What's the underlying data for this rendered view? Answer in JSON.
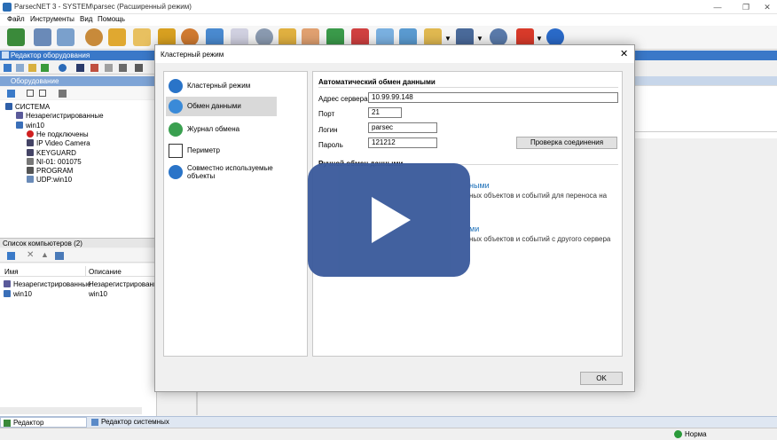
{
  "window": {
    "title": "ParsecNET 3 - SYSTEM\\parsec (Расширенный режим)"
  },
  "menu": [
    "Файл",
    "Инструменты",
    "Вид",
    "Помощь"
  ],
  "toolbar_icons": [
    "device-icon",
    "server-icon",
    "doc-icon",
    "person-icon",
    "home-icon",
    "grid-icon",
    "lock-icon",
    "group-icon",
    "monitor-icon",
    "calendar-icon",
    "gear-icon",
    "folder-icon",
    "table-icon",
    "chart-icon",
    "report-icon",
    "card-icon",
    "camera-icon",
    "export-icon",
    "network-icon",
    "user-icon",
    "delete-icon",
    "help-icon"
  ],
  "editor_panel": {
    "title": "Редактор оборудования"
  },
  "equipment_panel": {
    "title": "Оборудование"
  },
  "tree": [
    {
      "label": "СИСТЕМА",
      "level": 0,
      "icon": "system-icon",
      "color": "#2f5fa8"
    },
    {
      "label": "Незарегистрированные",
      "level": 1,
      "icon": "unregistered-icon",
      "color": "#5a5a9a"
    },
    {
      "label": "win10",
      "level": 1,
      "icon": "computer-icon",
      "color": "#3a6fb8"
    },
    {
      "label": "Не подключены",
      "level": 2,
      "icon": "disconnected-icon",
      "color": "#d02020"
    },
    {
      "label": "IP Video Camera",
      "level": 2,
      "icon": "camera-icon",
      "color": "#444466"
    },
    {
      "label": "KEYGUARD",
      "level": 2,
      "icon": "keyguard-icon",
      "color": "#444466"
    },
    {
      "label": "NI-01: 001075",
      "level": 2,
      "icon": "controller-icon",
      "color": "#777777"
    },
    {
      "label": "PROGRAM",
      "level": 2,
      "icon": "program-icon",
      "color": "#555555"
    },
    {
      "label": "UDP:win10",
      "level": 2,
      "icon": "udp-icon",
      "color": "#6a8bb8"
    }
  ],
  "computers_panel": {
    "title": "Список компьютеров (2)",
    "columns": [
      "Имя",
      "Описание"
    ],
    "rows": [
      {
        "name": "Незарегистрированные",
        "desc": "Незарегистрированные"
      },
      {
        "name": "win10",
        "desc": "win10"
      }
    ]
  },
  "dialog": {
    "title": "Кластерный режим",
    "nav": [
      {
        "label": "Кластерный режим",
        "icon": "cluster-icon",
        "color": "#2a74c8"
      },
      {
        "label": "Обмен данными",
        "icon": "exchange-icon",
        "color": "#3a8ad8",
        "selected": true
      },
      {
        "label": "Журнал обмена",
        "icon": "log-icon",
        "color": "#3aa050"
      },
      {
        "label": "Периметр",
        "icon": "perimeter-icon",
        "color": "#ffffff"
      },
      {
        "label": "Совместно используемые объекты",
        "icon": "shared-icon",
        "color": "#2a74c8"
      }
    ],
    "auto_section": "Автоматический обмен данными",
    "fields": {
      "server_label": "Адрес сервера",
      "server_value": "10.99.99.148",
      "port_label": "Порт",
      "port_value": "21",
      "login_label": "Логин",
      "login_value": "parsec",
      "password_label": "Пароль",
      "password_value": "121212"
    },
    "test_button": "Проверка соединения",
    "manual_section": "Ручной обмен данными",
    "manual_links": [
      {
        "title": "ными",
        "desc": "ных объектов и событий для переноса на"
      },
      {
        "title": "ми",
        "desc": "ных объектов и событий с другого сервера"
      }
    ],
    "ok_button": "OK"
  },
  "bottom_tabs": [
    "Редактор оборудования",
    "Редактор системных настроек"
  ],
  "status": {
    "text": "Норма",
    "color": "#2a9a3a"
  },
  "colors": {
    "panel_header": "#3a78c8",
    "video_overlay": "#3b5b9c"
  }
}
